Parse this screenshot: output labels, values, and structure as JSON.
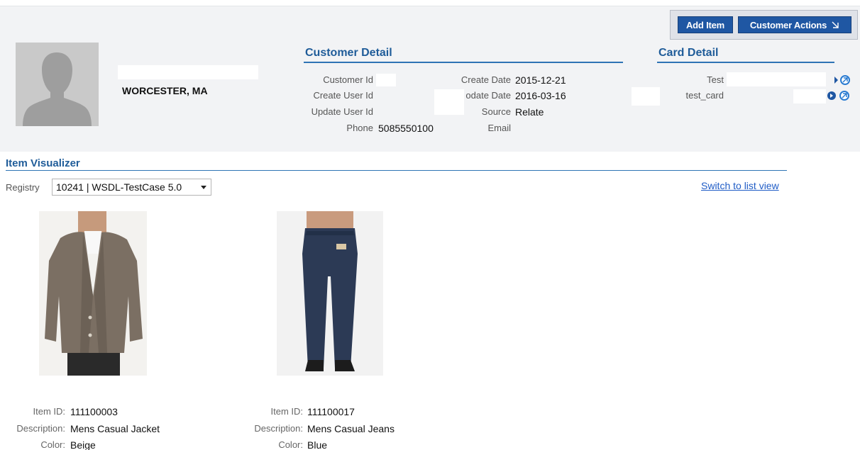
{
  "actions": {
    "add_item": "Add Item",
    "customer_actions": "Customer Actions"
  },
  "customer": {
    "location": "WORCESTER, MA"
  },
  "customer_detail": {
    "title": "Customer Detail",
    "customer_id_label": "Customer Id",
    "create_user_id_label": "Create User Id",
    "update_user_id_label": "Update User Id",
    "phone_label": "Phone",
    "phone_value": "5085550100",
    "create_date_label": "Create Date",
    "create_date_value": "2015-12-21",
    "update_date_label": "odate Date",
    "update_date_value": "2016-03-16",
    "source_label": "Source",
    "source_value": "Relate",
    "email_label": "Email"
  },
  "card_detail": {
    "title": "Card Detail",
    "cards": [
      "Test",
      "test_card"
    ]
  },
  "item_visualizer": {
    "title": "Item Visualizer",
    "registry_label": "Registry",
    "registry_selected": "10241 | WSDL-TestCase 5.0",
    "switch_link": "Switch to list view",
    "field_labels": {
      "item_id": "Item ID:",
      "description": "Description:",
      "color": "Color:"
    },
    "items": [
      {
        "item_id": "111100003",
        "description": "Mens Casual Jacket",
        "color": "Beige",
        "image": "jacket-photo"
      },
      {
        "item_id": "111100017",
        "description": "Mens Casual Jeans",
        "color": "Blue",
        "image": "jeans-photo"
      }
    ]
  },
  "colors": {
    "accent_blue": "#1f57a3",
    "section_title": "#1f5c99",
    "link": "#1f5cc6",
    "header_band": "#f2f3f5"
  }
}
